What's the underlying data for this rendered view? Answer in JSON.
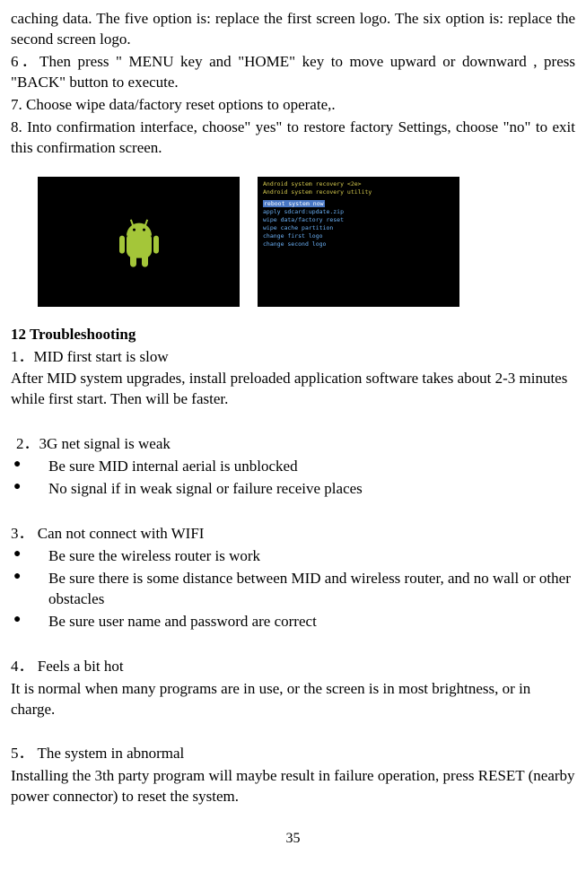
{
  "top": {
    "p1": "caching data. The five option is: replace  the first screen logo. The six option is: replace  the second screen logo.",
    "p2": "6．Then press \" MENU key and \"HOME\" key to move upward or downward , press \"BACK\" button to execute.",
    "p3": "7. Choose wipe data/factory reset options to operate,.",
    "p4": "8. Into confirmation interface, choose\" yes\" to restore factory Settings, choose \"no\" to exit this confirmation screen."
  },
  "recovery": {
    "line1": "Android system recovery <2e>",
    "line2": "Android system recovery utility",
    "reboot": "reboot system now",
    "opts": [
      "apply sdcard:update.zip",
      "wipe data/factory reset",
      "wipe cache partition",
      "change first logo",
      "change second logo"
    ]
  },
  "section": {
    "title": "12  Troubleshooting",
    "s1h": "1．MID first start is slow",
    "s1p": "After MID system upgrades, install preloaded application software takes about 2-3 minutes while first start. Then will be faster.",
    "s2h": " 2．3G net signal is weak",
    "s2b1": "Be sure MID internal aerial is unblocked",
    "s2b2": "No signal if in weak signal or failure receive places",
    "s3h": "3．  Can not connect with WIFI",
    "s3b1": "Be sure the wireless router is work",
    "s3b2": "Be sure there is some distance between MID and wireless router, and no wall or other obstacles",
    "s3b3": "Be sure user name and password are correct",
    "s4h": "4．  Feels a bit hot",
    "s4p": "It is normal when many programs are in use, or the screen is in most brightness, or in charge.",
    "s5h": "5．  The system in abnormal",
    "s5p": "Installing the 3th party program will maybe result in failure operation, press RESET (nearby power connector) to reset the system."
  },
  "page_number": "35"
}
